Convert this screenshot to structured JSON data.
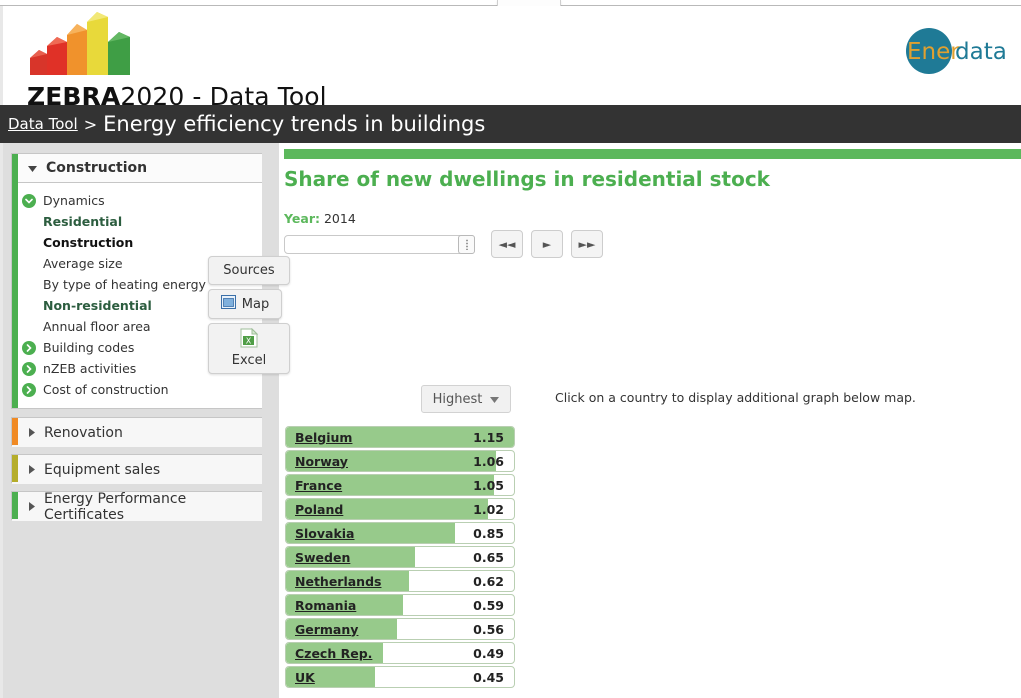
{
  "browser": {
    "chevron_icon": "chevron-down-icon"
  },
  "header": {
    "logo_mark_icon": "zebra-buildings-logo",
    "logo_bold": "ZEBRA",
    "logo_rest": "2020 - Data Tool",
    "brand_logo": {
      "icon": "enerdata-logo",
      "part1": "Ener",
      "part2": "data",
      "circle_color": "#1f7a96",
      "part1_color": "#e0a030",
      "part2_color": "#1f7a96"
    }
  },
  "breadcrumb": {
    "link": "Data Tool",
    "separator": ">",
    "title": "Energy efficiency trends in buildings"
  },
  "sidebar": {
    "panels": [
      {
        "title": "Construction",
        "accent_color": "#4caf50",
        "expanded": true,
        "triangle_icon": "triangle-down-icon",
        "items": [
          {
            "kind": "nav",
            "label": "Dynamics",
            "icon": "chevron-down-circle-icon"
          },
          {
            "kind": "group",
            "label": "Residential"
          },
          {
            "kind": "leaf",
            "label": "Construction",
            "active": true
          },
          {
            "kind": "leaf",
            "label": "Average size",
            "active": false
          },
          {
            "kind": "leaf",
            "label": "By type of heating energy",
            "active": false
          },
          {
            "kind": "group",
            "label": "Non-residential"
          },
          {
            "kind": "leaf",
            "label": "Annual floor area",
            "active": false
          },
          {
            "kind": "nav",
            "label": "Building codes",
            "icon": "chevron-right-circle-icon"
          },
          {
            "kind": "nav",
            "label": "nZEB activities",
            "icon": "chevron-right-circle-icon"
          },
          {
            "kind": "nav",
            "label": "Cost of construction",
            "icon": "chevron-right-circle-icon"
          }
        ]
      },
      {
        "title": "Renovation",
        "accent_color": "#f08a24",
        "expanded": false,
        "triangle_icon": "triangle-right-icon",
        "items": []
      },
      {
        "title": "Equipment sales",
        "accent_color": "#b5ad2b",
        "expanded": false,
        "triangle_icon": "triangle-right-icon",
        "items": []
      },
      {
        "title": "Energy Performance Certificates",
        "accent_color": "#4caf50",
        "expanded": false,
        "triangle_icon": "triangle-right-icon",
        "items": []
      }
    ]
  },
  "float_buttons": {
    "sources": "Sources",
    "map": "Map",
    "map_icon": "map-window-icon",
    "excel": "Excel",
    "excel_icon": "excel-file-icon"
  },
  "main": {
    "accent_color": "#5cb85c",
    "title": "Share of new dwellings in residential stock",
    "year": {
      "label": "Year:",
      "value": "2014",
      "handle_icon": "slider-grip-icon"
    },
    "controls": [
      {
        "name": "step-back-button",
        "glyph": "◄◄"
      },
      {
        "name": "play-button",
        "glyph": "►"
      },
      {
        "name": "step-forward-button",
        "glyph": "►►"
      }
    ],
    "sort_select": {
      "value": "Highest",
      "caret_icon": "caret-down-icon"
    },
    "map_hint": "Click on a country to display additional graph below map."
  },
  "chart_data": {
    "type": "bar",
    "title": "Share of new dwellings in residential stock",
    "subtitle": "Year: 2014",
    "orientation": "horizontal",
    "sort": "Highest",
    "xlabel": "",
    "ylabel": "",
    "xlim": [
      0,
      1.15
    ],
    "grid": false,
    "legend": "none",
    "categories": [
      "Belgium",
      "Norway",
      "France",
      "Poland",
      "Slovakia",
      "Sweden",
      "Netherlands",
      "Romania",
      "Germany",
      "Czech Rep.",
      "UK"
    ],
    "values": [
      1.15,
      1.06,
      1.05,
      1.02,
      0.85,
      0.65,
      0.62,
      0.59,
      0.56,
      0.49,
      0.45
    ],
    "bar_color": "#97ca8b",
    "track_color": "#ffffff"
  }
}
